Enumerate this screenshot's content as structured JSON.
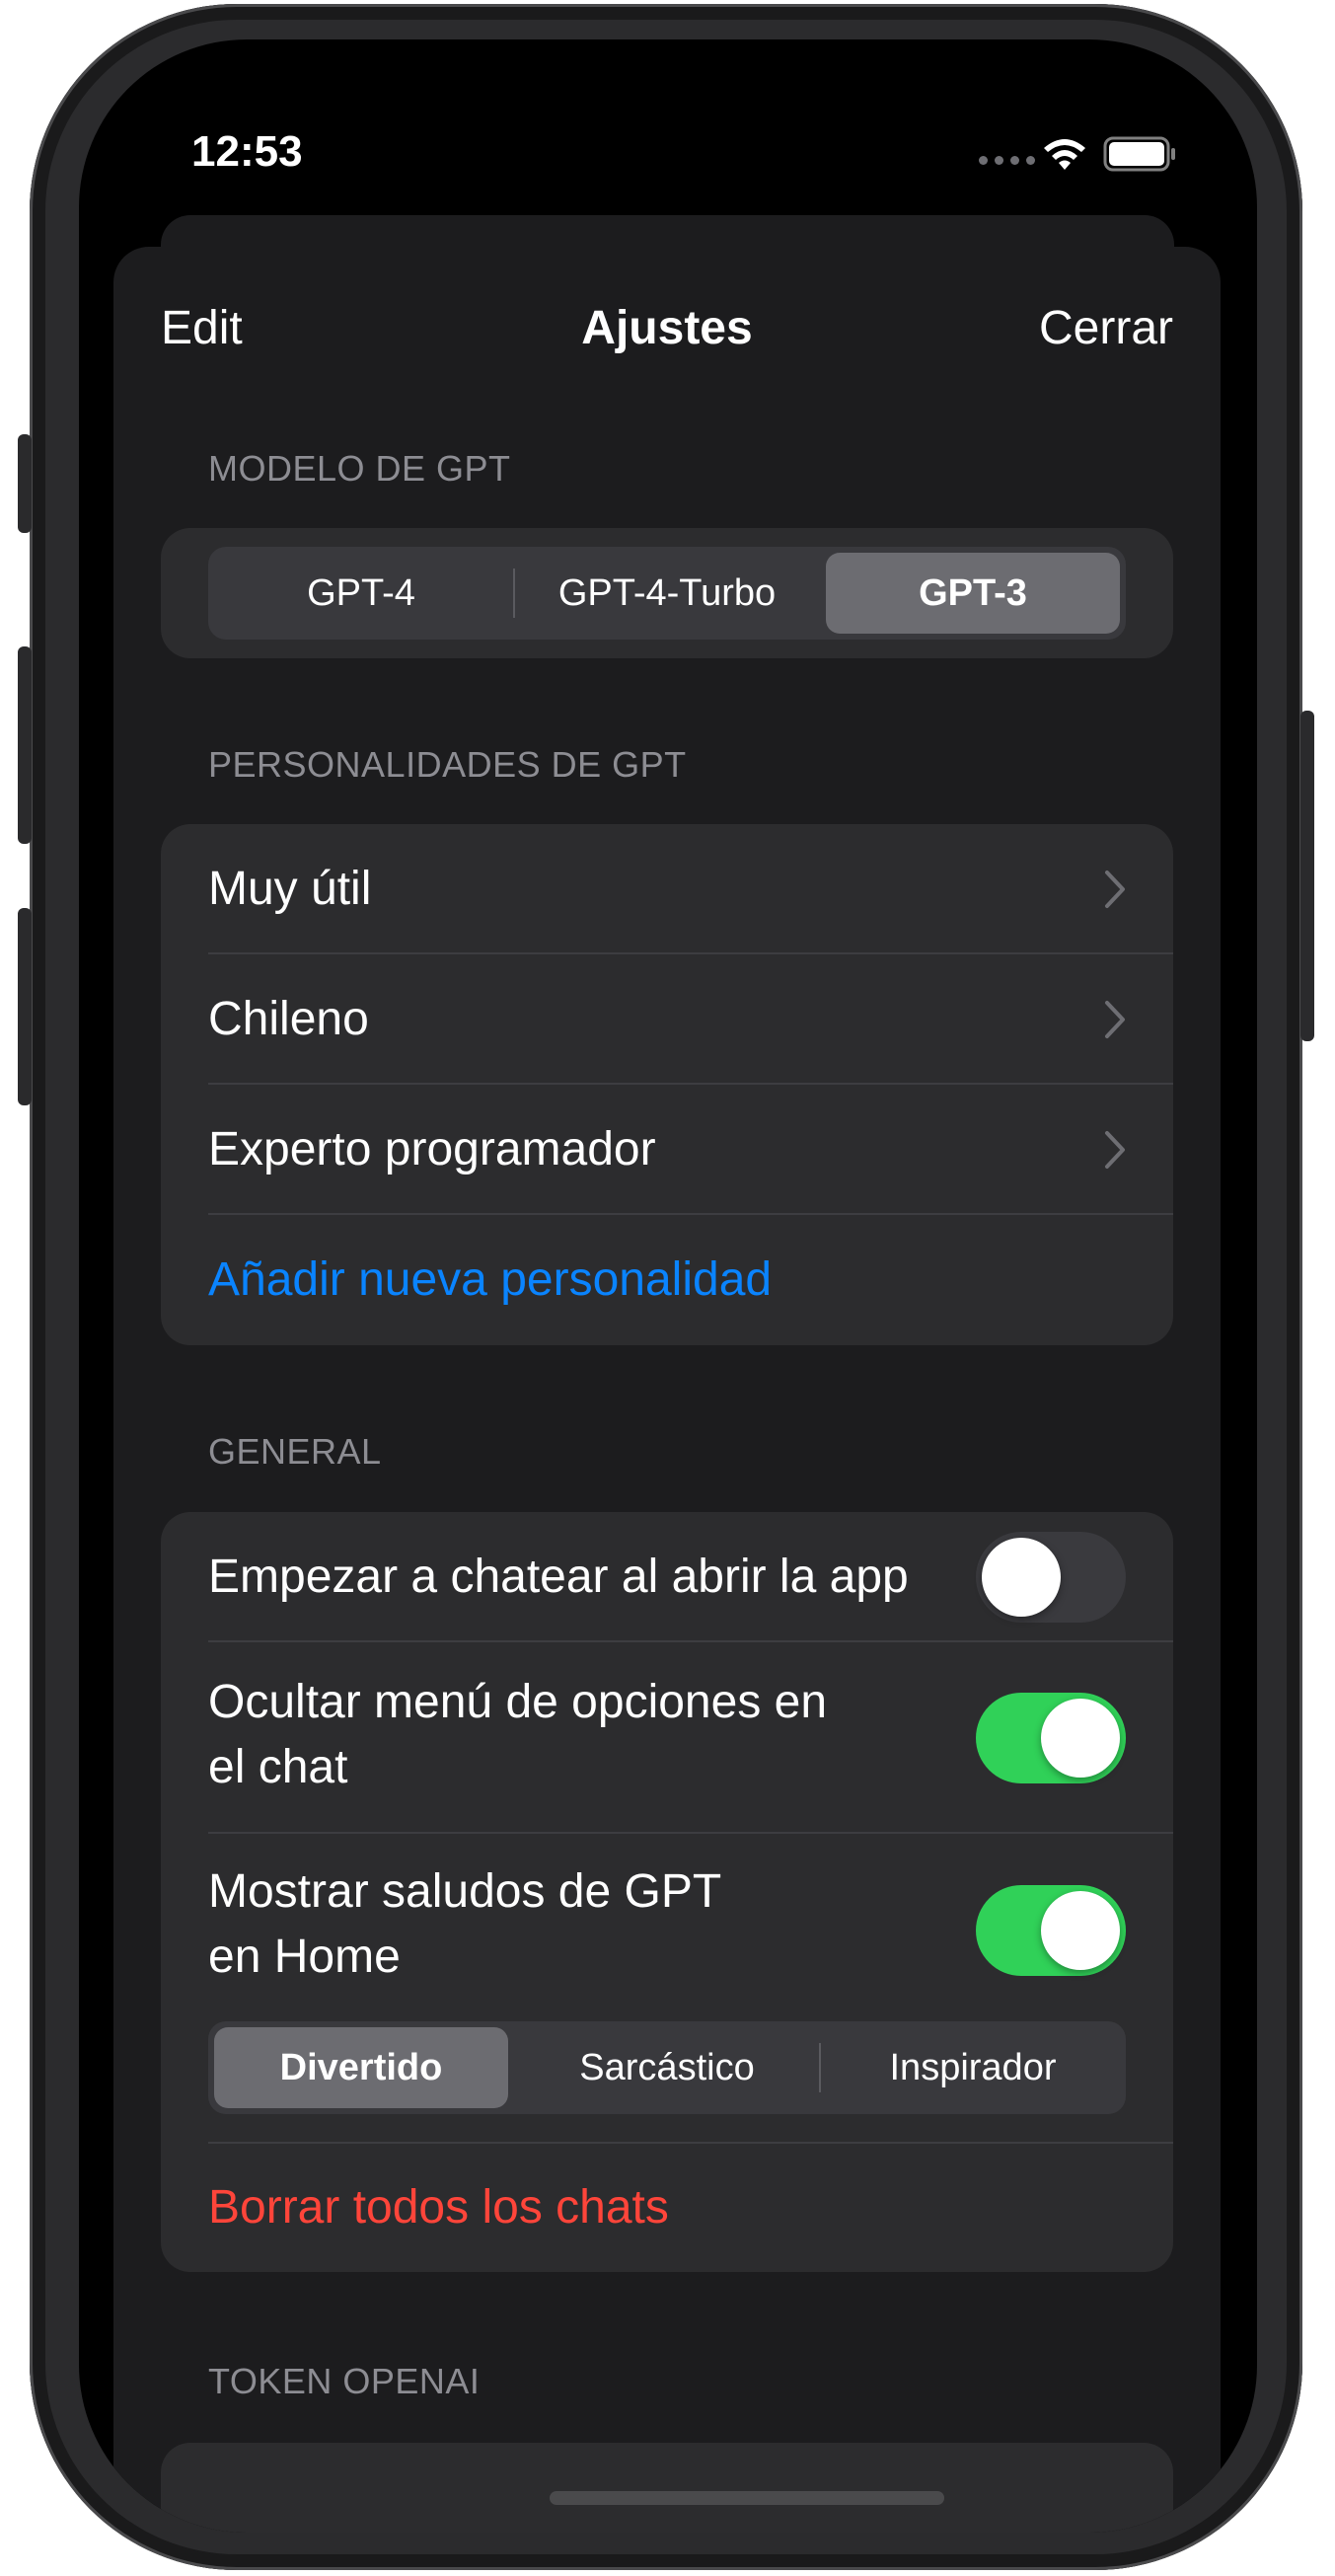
{
  "status_bar": {
    "time": "12:53"
  },
  "nav": {
    "edit_label": "Edit",
    "title": "Ajustes",
    "close_label": "Cerrar"
  },
  "gpt_model": {
    "header": "MODELO DE GPT",
    "options": [
      "GPT-4",
      "GPT-4-Turbo",
      "GPT-3"
    ],
    "selected": "GPT-3"
  },
  "personalities": {
    "header": "PERSONALIDADES DE GPT",
    "items": [
      {
        "label": "Muy útil"
      },
      {
        "label": "Chileno"
      },
      {
        "label": "Experto programador"
      }
    ],
    "add_label": "Añadir nueva personalidad"
  },
  "general": {
    "header": "GENERAL",
    "toggles": [
      {
        "label": "Empezar a chatear al abrir la app",
        "on": false
      },
      {
        "label": "Ocultar menú de opciones en\nel chat",
        "on": true
      },
      {
        "label": "Mostrar saludos de GPT\nen Home",
        "on": true
      }
    ],
    "greeting_styles": [
      "Divertido",
      "Sarcástico",
      "Inspirador"
    ],
    "greeting_selected": "Divertido",
    "delete_label": "Borrar todos los chats"
  },
  "token": {
    "header": "TOKEN OPENAI"
  },
  "colors": {
    "accent": "#0a84ff",
    "destructive": "#ff453a",
    "toggle_on": "#30d158",
    "sheet_background": "#1c1c1e",
    "group_background": "#2c2c2e"
  }
}
